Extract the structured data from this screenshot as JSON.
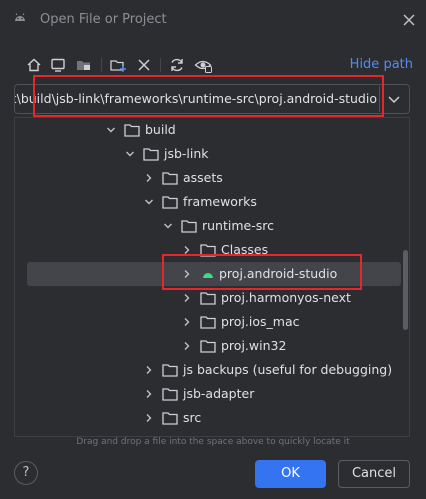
{
  "window": {
    "title": "Open File or Project"
  },
  "toolbar": {
    "icons": [
      "home-icon",
      "desktop-icon",
      "project-folder-icon",
      "new-folder-icon",
      "delete-icon",
      "refresh-icon",
      "show-hidden-icon"
    ],
    "hide_path_label": "Hide path"
  },
  "path": {
    "value": "apk\\build\\jsb-link\\frameworks\\runtime-src\\proj.android-studio"
  },
  "tree": {
    "rows": [
      {
        "label": "build",
        "depth": 0,
        "expanded": true
      },
      {
        "label": "jsb-link",
        "depth": 1,
        "expanded": true
      },
      {
        "label": "assets",
        "depth": 2,
        "expanded": false
      },
      {
        "label": "frameworks",
        "depth": 2,
        "expanded": true
      },
      {
        "label": "runtime-src",
        "depth": 3,
        "expanded": true
      },
      {
        "label": "Classes",
        "depth": 4,
        "expanded": false
      },
      {
        "label": "proj.android-studio",
        "depth": 4,
        "expanded": false,
        "selected": true,
        "icon": "android-icon"
      },
      {
        "label": "proj.harmonyos-next",
        "depth": 4,
        "expanded": false
      },
      {
        "label": "proj.ios_mac",
        "depth": 4,
        "expanded": false
      },
      {
        "label": "proj.win32",
        "depth": 4,
        "expanded": false
      },
      {
        "label": "js backups (useful for debugging)",
        "depth": 2,
        "expanded": false
      },
      {
        "label": "jsb-adapter",
        "depth": 2,
        "expanded": false
      },
      {
        "label": "src",
        "depth": 2,
        "expanded": false
      }
    ]
  },
  "hint": "Drag and drop a file into the space above to quickly locate it",
  "footer": {
    "help_label": "?",
    "ok_label": "OK",
    "cancel_label": "Cancel"
  },
  "colors": {
    "accent": "#3574f0",
    "link": "#548af7",
    "highlight": "#e5262c",
    "android": "#3ddc84"
  }
}
